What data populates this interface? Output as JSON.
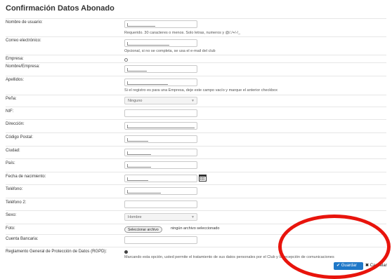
{
  "page_title": "Confirmación Datos Abonado",
  "fields": {
    "usuario": {
      "label": "Nombre de usuario:",
      "help": "Requerido. 30 caracteres o menos. Solo letras, numeros y @/./+/-/_"
    },
    "correo": {
      "label": "Correo electrónico:",
      "help": "Opcional, si no se completa, se usa el e-mail del club"
    },
    "empresa": {
      "label": "Empresa:"
    },
    "nombre": {
      "label": "Nombre/Empresa:"
    },
    "apellidos": {
      "label": "Apellidos:",
      "help": "Si el registro es para una Empresa, deje este campo vacío y marque el anterior checkbox"
    },
    "pena": {
      "label": "Peña:",
      "value": "Ninguno"
    },
    "nif": {
      "label": "NIF:"
    },
    "direccion": {
      "label": "Dirección:"
    },
    "cp": {
      "label": "Código Postal:"
    },
    "ciudad": {
      "label": "Ciudad:"
    },
    "pais": {
      "label": "País:"
    },
    "nacimiento": {
      "label": "Fecha de nacimiento:"
    },
    "telefono": {
      "label": "Teléfono:"
    },
    "telefono2": {
      "label": "Teléfono 2:"
    },
    "sexo": {
      "label": "Sexo:",
      "value": "Hombre"
    },
    "foto": {
      "label": "Foto:",
      "button": "Seleccionar archivo",
      "status": "ningún archivo seleccionado"
    },
    "cuenta": {
      "label": "Cuenta Bancaria:"
    },
    "rgpd": {
      "label": "Reglamento General de Protección de Datos (RGPD):",
      "help": "Marcando esta opción, usted permite el tratamiento de sus datos personales por el Club y la recepción de comunicaciones"
    }
  },
  "actions": {
    "save": "Guardar",
    "cancel": "Cancelar"
  },
  "colors": {
    "primary": "#1f78c8",
    "annotation": "#e8140c"
  }
}
